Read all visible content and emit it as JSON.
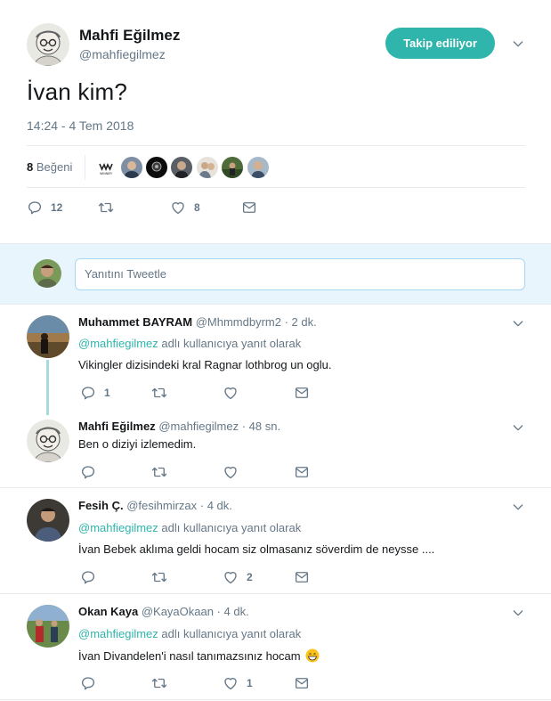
{
  "main": {
    "name": "Mahfi Eğilmez",
    "handle": "@mahfiegilmez",
    "follow_label": "Takip ediliyor",
    "text": "İvan kim?",
    "time": "14:24 - 4 Tem 2018",
    "likes_count": "8",
    "likes_label": "Beğeni",
    "liker_logo_text": "WINNER",
    "actions": {
      "replies": "12",
      "retweets": "",
      "likes": "8"
    }
  },
  "reply_box": {
    "placeholder": "Yanıtını Tweetle"
  },
  "replies": [
    {
      "name": "Muhammet BAYRAM",
      "handle": "@Mhmmdbyrm2",
      "time": "· 2 dk.",
      "reply_to_mention": "@mahfiegilmez",
      "reply_to_suffix": " adlı kullanıcıya yanıt olarak",
      "text": "Vikingler dizisindeki kral Ragnar lothbrog un oglu.",
      "replies": "1",
      "likes": ""
    },
    {
      "name": "Mahfi Eğilmez",
      "handle": "@mahfiegilmez",
      "time": "· 48 sn.",
      "text": "Ben o diziyi izlemedim.",
      "replies": "",
      "likes": ""
    },
    {
      "name": "Fesih Ç.",
      "handle": "@fesihmirzax",
      "time": "· 4 dk.",
      "reply_to_mention": "@mahfiegilmez",
      "reply_to_suffix": " adlı kullanıcıya yanıt olarak",
      "text": "İvan Bebek aklıma geldi hocam siz olmasanız söverdim de neysse ....",
      "replies": "",
      "likes": "2"
    },
    {
      "name": "Okan Kaya",
      "handle": "@KayaOkaan",
      "time": "· 4 dk.",
      "reply_to_mention": "@mahfiegilmez",
      "reply_to_suffix": " adlı kullanıcıya yanıt olarak",
      "text": "İvan Divandelen'i nasıl tanımazsınız hocam",
      "replies": "",
      "likes": "1"
    }
  ],
  "colors": {
    "accent": "#2fb5ab",
    "muted": "#657786",
    "thread": "#a5dbe0",
    "reply_bg": "#e8f5fd"
  },
  "icons": [
    "reply-icon",
    "retweet-icon",
    "heart-icon",
    "message-icon",
    "chevron-down-icon"
  ]
}
